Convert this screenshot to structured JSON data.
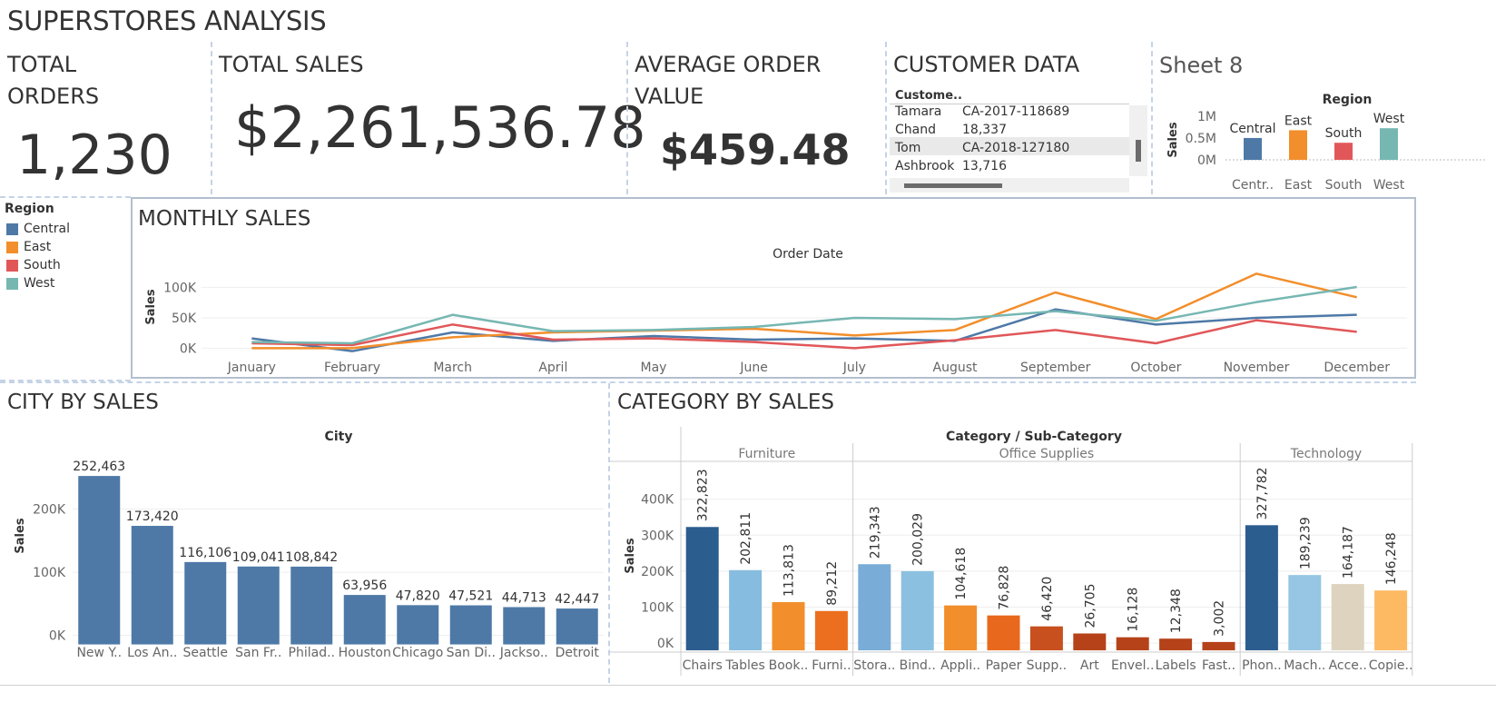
{
  "dashboard_title": "SUPERSTORES ANALYSIS",
  "kpis": {
    "orders_title_1": "TOTAL",
    "orders_title_2": "ORDERS",
    "orders_value": "1,230",
    "sales_title": "TOTAL SALES",
    "sales_value": "$2,261,536.78",
    "aov_title_1": "AVERAGE ORDER",
    "aov_title_2": "VALUE",
    "aov_value": "$459.48"
  },
  "customer": {
    "title": "CUSTOMER DATA",
    "header": "Custome..",
    "rows": [
      {
        "name": "Tamara",
        "value": "CA-2017-118689"
      },
      {
        "name": "Chand",
        "value": "18,337"
      },
      {
        "name": "Tom",
        "value": "CA-2018-127180"
      },
      {
        "name": "Ashbrook",
        "value": "13,716"
      }
    ]
  },
  "sheet8": {
    "title": "Sheet 8"
  },
  "colors": {
    "central": "#4e79a7",
    "east": "#f28e2b",
    "south": "#e15759",
    "west": "#76b7b2",
    "city_bar": "#4e79a7"
  },
  "legend": {
    "title": "Region",
    "items": [
      {
        "label": "Central",
        "color": "#4e79a7"
      },
      {
        "label": "East",
        "color": "#f28e2b"
      },
      {
        "label": "South",
        "color": "#e15759"
      },
      {
        "label": "West",
        "color": "#76b7b2"
      }
    ]
  },
  "monthly": {
    "title": "MONTHLY SALES"
  },
  "city": {
    "title": "CITY BY SALES"
  },
  "category": {
    "title": "CATEGORY BY SALES"
  },
  "chart_data": [
    {
      "id": "region",
      "type": "bar",
      "title": "Region",
      "ylabel": "Sales",
      "ylim": [
        0,
        1000000
      ],
      "yticks": [
        {
          "v": 1000000,
          "label": "1M"
        },
        {
          "v": 500000,
          "label": "0.5M"
        },
        {
          "v": 0,
          "label": "0M"
        }
      ],
      "categories": [
        "Central",
        "East",
        "South",
        "West"
      ],
      "tick_labels": [
        "Centr..",
        "East",
        "South",
        "West"
      ],
      "values": [
        501240,
        678781,
        391722,
        725458
      ],
      "colors": [
        "#4e79a7",
        "#f28e2b",
        "#e15759",
        "#76b7b2"
      ]
    },
    {
      "id": "monthly",
      "type": "line",
      "title": "Order Date",
      "ylabel": "Sales",
      "ylim": [
        -10000,
        140000
      ],
      "yticks": [
        {
          "v": 100000,
          "label": "100K"
        },
        {
          "v": 50000,
          "label": "50K"
        },
        {
          "v": 0,
          "label": "0K"
        }
      ],
      "x": [
        "January",
        "February",
        "March",
        "April",
        "May",
        "June",
        "July",
        "August",
        "September",
        "October",
        "November",
        "December"
      ],
      "series": [
        {
          "name": "Central",
          "color": "#4e79a7",
          "values": [
            16000,
            -5000,
            26000,
            12000,
            20000,
            14000,
            16000,
            12000,
            64000,
            39000,
            50000,
            55000
          ]
        },
        {
          "name": "East",
          "color": "#f28e2b",
          "values": [
            0,
            0,
            18000,
            26000,
            29000,
            32000,
            21000,
            30000,
            92000,
            48000,
            123000,
            84000
          ]
        },
        {
          "name": "South",
          "color": "#e15759",
          "values": [
            8000,
            5000,
            39000,
            14000,
            16000,
            10000,
            0,
            13000,
            30000,
            8000,
            46000,
            27000
          ]
        },
        {
          "name": "West",
          "color": "#76b7b2",
          "values": [
            10000,
            8000,
            55000,
            28000,
            30000,
            35000,
            50000,
            48000,
            61000,
            45000,
            76000,
            101000
          ]
        }
      ]
    },
    {
      "id": "city",
      "type": "bar",
      "title": "City",
      "ylabel": "Sales",
      "ylim": [
        -15000,
        290000
      ],
      "yticks": [
        {
          "v": 200000,
          "label": "200K"
        },
        {
          "v": 100000,
          "label": "100K"
        },
        {
          "v": 0,
          "label": "0K"
        }
      ],
      "categories": [
        "New York City",
        "Los Angeles",
        "Seattle",
        "San Francisco",
        "Philadelphia",
        "Houston",
        "Chicago",
        "San Diego",
        "Jacksonville",
        "Detroit"
      ],
      "tick_labels": [
        "New Y..",
        "Los An..",
        "Seattle",
        "San Fr..",
        "Philad..",
        "Houston",
        "Chicago",
        "San Di..",
        "Jackso..",
        "Detroit"
      ],
      "values": [
        252463,
        173420,
        116106,
        109041,
        108842,
        63956,
        47820,
        47521,
        44713,
        42447
      ],
      "data_labels": [
        "252,463",
        "173,420",
        "116,106",
        "109,041",
        "108,842",
        "63,956",
        "47,820",
        "47,521",
        "44,713",
        "42,447"
      ]
    },
    {
      "id": "category",
      "type": "bar",
      "title": "Category / Sub-Category",
      "ylabel": "Sales",
      "ylim": [
        -20000,
        470000
      ],
      "yticks": [
        {
          "v": 400000,
          "label": "400K"
        },
        {
          "v": 300000,
          "label": "300K"
        },
        {
          "v": 200000,
          "label": "200K"
        },
        {
          "v": 100000,
          "label": "100K"
        },
        {
          "v": 0,
          "label": "0K"
        }
      ],
      "groups": [
        {
          "name": "Furniture",
          "count": 4
        },
        {
          "name": "Office Supplies",
          "count": 9
        },
        {
          "name": "Technology",
          "count": 4
        }
      ],
      "categories": [
        "Chairs",
        "Tables",
        "Bookcases",
        "Furnishings",
        "Storage",
        "Binders",
        "Appliances",
        "Paper",
        "Supplies",
        "Art",
        "Envelopes",
        "Labels",
        "Fasteners",
        "Phones",
        "Machines",
        "Accessories",
        "Copiers"
      ],
      "tick_labels": [
        "Chairs",
        "Tables",
        "Book..",
        "Furni..",
        "Stora..",
        "Bind..",
        "Appli..",
        "Paper",
        "Supp..",
        "Art",
        "Envel..",
        "Labels",
        "Fast..",
        "Phon..",
        "Mach..",
        "Acce..",
        "Copie.."
      ],
      "values": [
        322823,
        202811,
        113813,
        89212,
        219343,
        200029,
        104618,
        76828,
        46420,
        26705,
        16128,
        12348,
        3002,
        327782,
        189239,
        164187,
        146248
      ],
      "data_labels": [
        "322,823",
        "202,811",
        "113,813",
        "89,212",
        "219,343",
        "200,029",
        "104,618",
        "76,828",
        "46,420",
        "26,705",
        "16,128",
        "12,348",
        "3,002",
        "327,782",
        "189,239",
        "164,187",
        "146,248"
      ],
      "colors": [
        "#2c5d8f",
        "#86bcdf",
        "#f28e2b",
        "#eb6f1f",
        "#79acd6",
        "#8cc0e0",
        "#f28e2b",
        "#e8691d",
        "#c7501e",
        "#b6421a",
        "#b6421a",
        "#b6421a",
        "#b6421a",
        "#2c5d8f",
        "#96c6e3",
        "#ddd3bf",
        "#fdba63"
      ]
    }
  ]
}
